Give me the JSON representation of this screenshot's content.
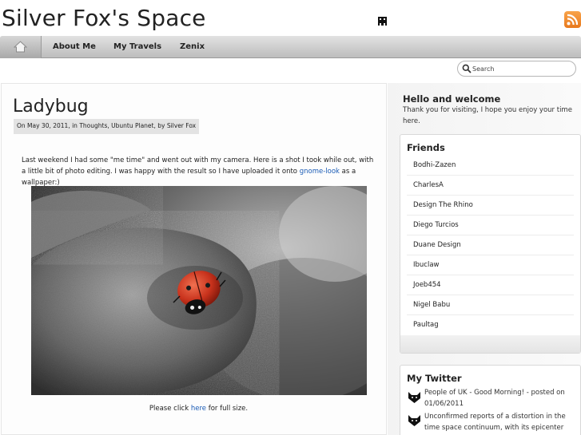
{
  "header": {
    "site_title": "Silver Fox's Space",
    "icons": [
      "pixel-badge-icon",
      "rss-feed-icon"
    ],
    "accent_color": "#f08a24"
  },
  "nav": {
    "home_icon": "home-icon",
    "items": [
      {
        "label": "About Me"
      },
      {
        "label": "My Travels"
      },
      {
        "label": "Zenix"
      }
    ]
  },
  "search": {
    "placeholder": "Search",
    "icon": "search-icon"
  },
  "post": {
    "title": "Ladybug",
    "meta": "On May 30, 2011, in Thoughts, Ubuntu Planet, by Silver Fox",
    "text_before_link": "Last weekend I had some \"me time\" and went out with my camera.  Here is a shot I took while out, with a little bit of photo editing.  I was happy with the result so I have uploaded it onto ",
    "link_text": "gnome-look",
    "text_after_link": " as a wallpaper:)",
    "caption_before": "Please click ",
    "caption_link": "here",
    "caption_after": " for full size.",
    "link_color": "#1a5bb5"
  },
  "sidebar": {
    "welcome": {
      "title": "Hello and welcome",
      "text": "Thank you for visiting, I hope you enjoy your time here."
    },
    "friends": {
      "title": "Friends",
      "items": [
        {
          "label": "Bodhi-Zazen"
        },
        {
          "label": "CharlesA"
        },
        {
          "label": "Design The Rhino"
        },
        {
          "label": "Diego Turcios"
        },
        {
          "label": "Duane Design"
        },
        {
          "label": "Ibuclaw"
        },
        {
          "label": "Joeb454"
        },
        {
          "label": "Nigel Babu"
        },
        {
          "label": "Paultag"
        }
      ]
    },
    "twitter": {
      "title": "My Twitter",
      "icon": "twitter-fox-icon",
      "tweets": [
        {
          "text": "People of UK - Good Morning! - posted on 01/06/2011"
        },
        {
          "text": "Unconfirmed reports of a distortion in the time space continuum, with its epicenter"
        }
      ]
    }
  }
}
